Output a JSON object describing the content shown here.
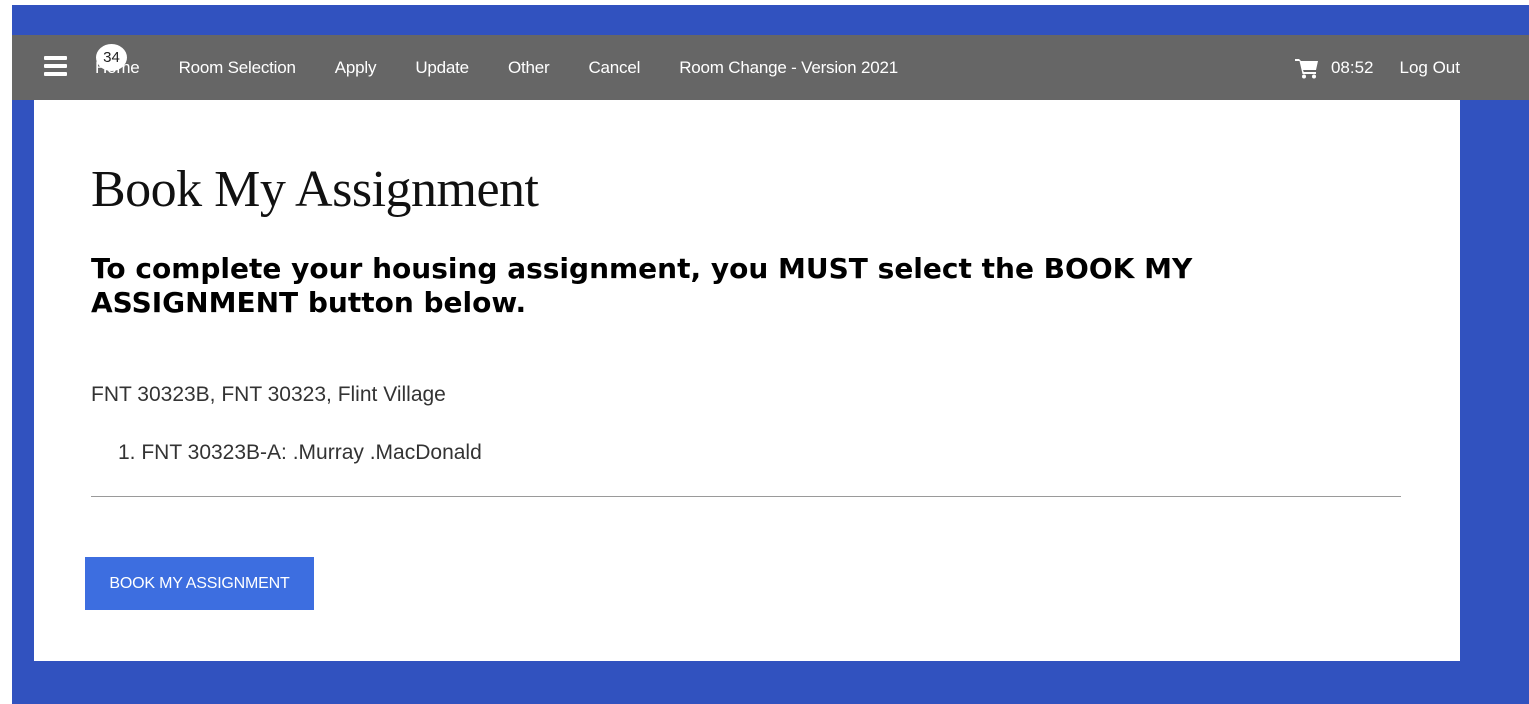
{
  "navbar": {
    "badge_count": "34",
    "menu_icon": "hamburger-menu-icon",
    "links": [
      {
        "label": "Home"
      },
      {
        "label": "Room Selection"
      },
      {
        "label": "Apply"
      },
      {
        "label": "Update"
      },
      {
        "label": "Other"
      },
      {
        "label": "Cancel"
      },
      {
        "label": "Room Change - Version 2021"
      }
    ],
    "cart_icon": "shopping-cart-icon",
    "timer": "08:52",
    "logout_label": "Log Out"
  },
  "main": {
    "title": "Book My Assignment",
    "instruction": "To complete your housing assignment, you MUST select the BOOK MY ASSIGNMENT button below.",
    "assignment": "FNT 30323B, FNT 30323, Flint Village",
    "occupants": [
      {
        "number": "1.",
        "text": "FNT 30323B-A: .Murray .MacDonald"
      }
    ],
    "book_button_label": "BOOK MY ASSIGNMENT"
  },
  "colors": {
    "frame_blue": "#3152bf",
    "navbar_gray": "#666666",
    "button_blue": "#3d6ee0"
  }
}
